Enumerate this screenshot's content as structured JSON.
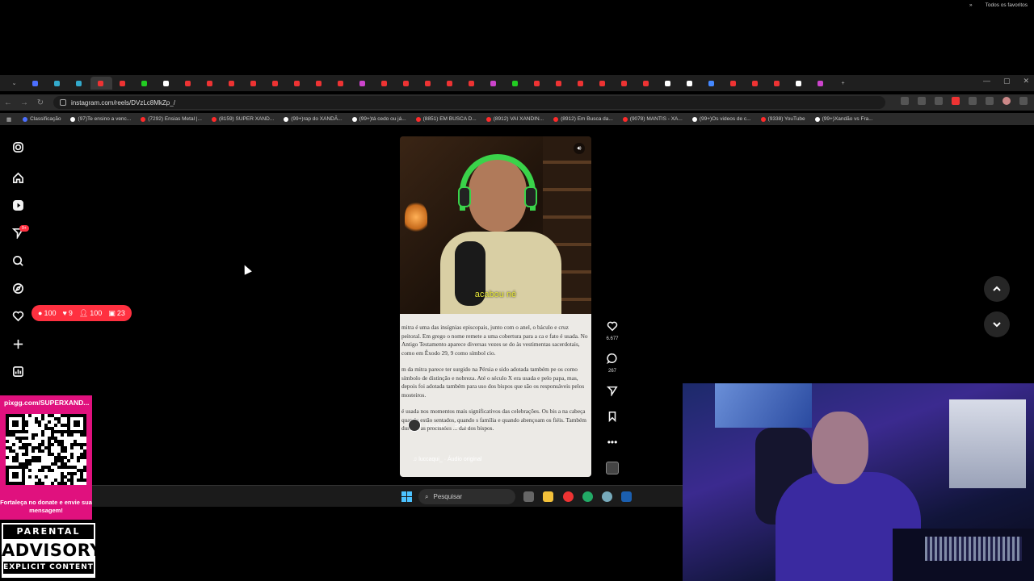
{
  "browser": {
    "url": "instagram.com/reels/DVzLc8MkZp_/",
    "bookmarks": [
      {
        "label": "Classificação",
        "color": "#4c6fff"
      },
      {
        "label": "(97)Te ensino a venc...",
        "color": "#ffffff"
      },
      {
        "label": "(7292) Ensias Metal |...",
        "color": "#ff2a2a"
      },
      {
        "label": "(8159) SUPER XAND...",
        "color": "#ff2a2a"
      },
      {
        "label": "(99+)rap do XANDÃ...",
        "color": "#ffffff"
      },
      {
        "label": "(99+)tá cedo ou já...",
        "color": "#ffffff"
      },
      {
        "label": "(8851) EM BUSCA D...",
        "color": "#ff2a2a"
      },
      {
        "label": "(8912) VAI XANDIN...",
        "color": "#ff2a2a"
      },
      {
        "label": "(8912) Em Busca da...",
        "color": "#ff2a2a"
      },
      {
        "label": "(9078) MANTIS - XA...",
        "color": "#ff2a2a"
      },
      {
        "label": "(99+)Os videos de c...",
        "color": "#ffffff"
      },
      {
        "label": "(9338) YouTube",
        "color": "#ff2a2a"
      },
      {
        "label": "(99+)Xandão vs Fra...",
        "color": "#ffffff"
      }
    ],
    "all_bookmarks": "Todos os favoritos"
  },
  "instagram": {
    "counters": {
      "comments": "100",
      "likes": "9",
      "followers": "100",
      "profile": "23"
    },
    "notif_badge": "9+",
    "reel": {
      "caption": "acabou né",
      "doc_paragraphs": [
        "mitra é uma das insígnias episcopais, junto com o anel, o báculo e cruz peitoral. Em grego o nome remete a uma cobertura para a ca e fato é usada. No Antigo Testamento aparece diversas vezes se do às vestimentas sacerdotais, como em Êxodo 29, 9 como símbol cio.",
        "m da mitra parece ter surgido na Pérsia e sido adotada também pe os como símbolo de distinção e nobreza. Até o século X era usada e pelo papa, mas, depois foi adotada também para uso dos bispos que são os responsáveis pelos mosteiros.",
        "é usada nos momentos mais significativos das celebrações. Os bis a na cabeça quando estão sentados, quando s família e quando abençoam os fiéis. Também durante as procissões ... dal dos bispos."
      ],
      "author": "luccaqui_",
      "follow": "Seguir",
      "audio": "♫ luccaqui_ · Áudio original",
      "likes": "6.677",
      "comments": "267"
    }
  },
  "taskbar": {
    "search_placeholder": "Pesquisar"
  },
  "overlay": {
    "donate_url": "pixgg.com/SUPERXAND...",
    "donate_msg": "Fortaleça no donate e envie sua mensagem!",
    "advisory_top": "PARENTAL",
    "advisory_mid": "ADVISORY",
    "advisory_bot": "EXPLICIT CONTENT"
  }
}
